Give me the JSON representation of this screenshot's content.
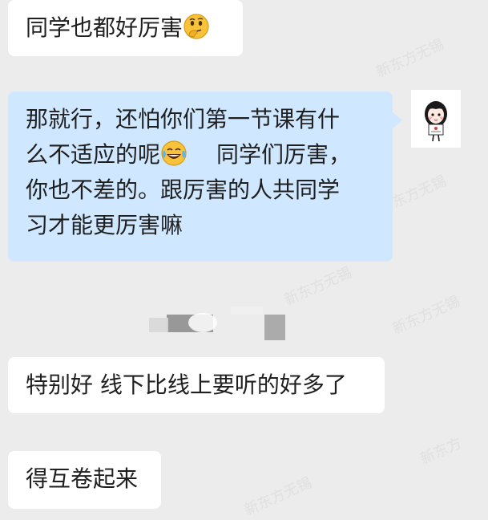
{
  "messages": [
    {
      "side": "left",
      "text": "同学也都好厉害",
      "emoji": "thinking-face"
    },
    {
      "side": "right",
      "lines": [
        "那就行，还怕你们第一节课有什",
        "么不适应的呢",
        "你也不差的。跟厉害的人共同学",
        "习才能更厉害嘛"
      ],
      "line2_tail": "同学们厉害，",
      "emoji": "tears-of-joy-face"
    },
    {
      "side": "left",
      "text": "特别好 线下比线上要听的好多了"
    },
    {
      "side": "left",
      "text": "得互卷起来"
    }
  ],
  "colors": {
    "background": "#ececec",
    "left_bubble": "#ffffff",
    "right_bubble": "#cfe7ff",
    "text": "#1f1f1f"
  }
}
